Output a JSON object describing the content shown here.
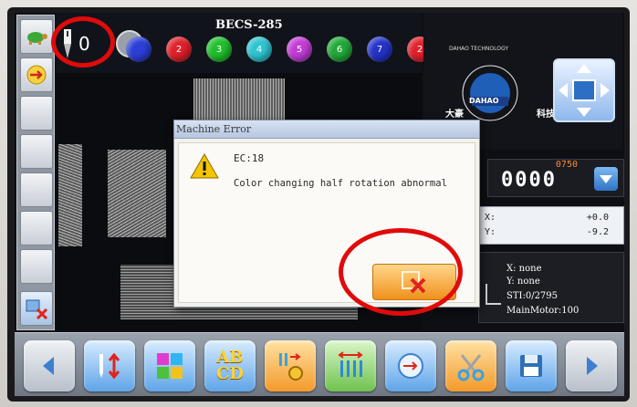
{
  "top_bar": {
    "needle_value": "0",
    "machine_name": "BECS-285",
    "needle_colors": [
      {
        "label": "",
        "color": "#2b3fd6"
      },
      {
        "label": "2",
        "color": "#e0202a"
      },
      {
        "label": "3",
        "color": "#1fbf2c"
      },
      {
        "label": "4",
        "color": "#2ec4d0"
      },
      {
        "label": "5",
        "color": "#c23bd6"
      },
      {
        "label": "6",
        "color": "#22a83a"
      },
      {
        "label": "7",
        "color": "#2433c8"
      },
      {
        "label": "2",
        "color": "#e0202a"
      }
    ]
  },
  "brand": {
    "name_cn_left": "大豪",
    "name_cn_right": "科技",
    "logo_text": "DAHAO",
    "logo_ring_text": "DAHAO TECHNOLOGY"
  },
  "stitch_counter": {
    "small_value": "0750",
    "big_value": "0000"
  },
  "position": {
    "x_label": "X:",
    "x_value": "+0.0",
    "y_label": "Y:",
    "y_value": "-9.2"
  },
  "status": {
    "x_line": "X: none",
    "y_line": "Y: none",
    "sti_line": "STI:0/2795",
    "motor_line": "MainMotor:100"
  },
  "dialog": {
    "title": "Machine Error",
    "code": "EC:18",
    "message": "Color changing half rotation abnormal"
  },
  "bottom_toolbar": {
    "abcd_top": "AB",
    "abcd_bottom": "CD"
  },
  "colors": {
    "annotation_red": "#e00b0b",
    "dialog_title_bg": "#c7d5ea",
    "close_button": "#f0911c"
  }
}
